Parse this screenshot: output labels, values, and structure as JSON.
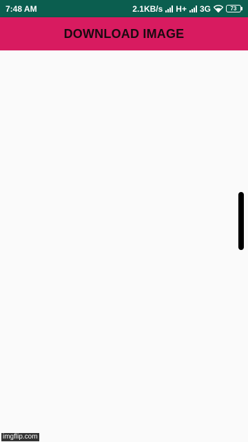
{
  "status_bar": {
    "time": "7:48 AM",
    "speed": "2.1KB/s",
    "network_hplus": "H+",
    "network_3g": "3G",
    "battery": "73",
    "icons": [
      "signal-icon",
      "signal-icon",
      "wifi-icon",
      "battery-icon"
    ]
  },
  "app_bar": {
    "title": "DOWNLOAD IMAGE"
  },
  "watermark": "imgflip.com",
  "colors": {
    "status_bar": "#0b5e4f",
    "app_bar": "#d81b60",
    "background": "#fafafa",
    "scroll_handle": "#000000"
  }
}
